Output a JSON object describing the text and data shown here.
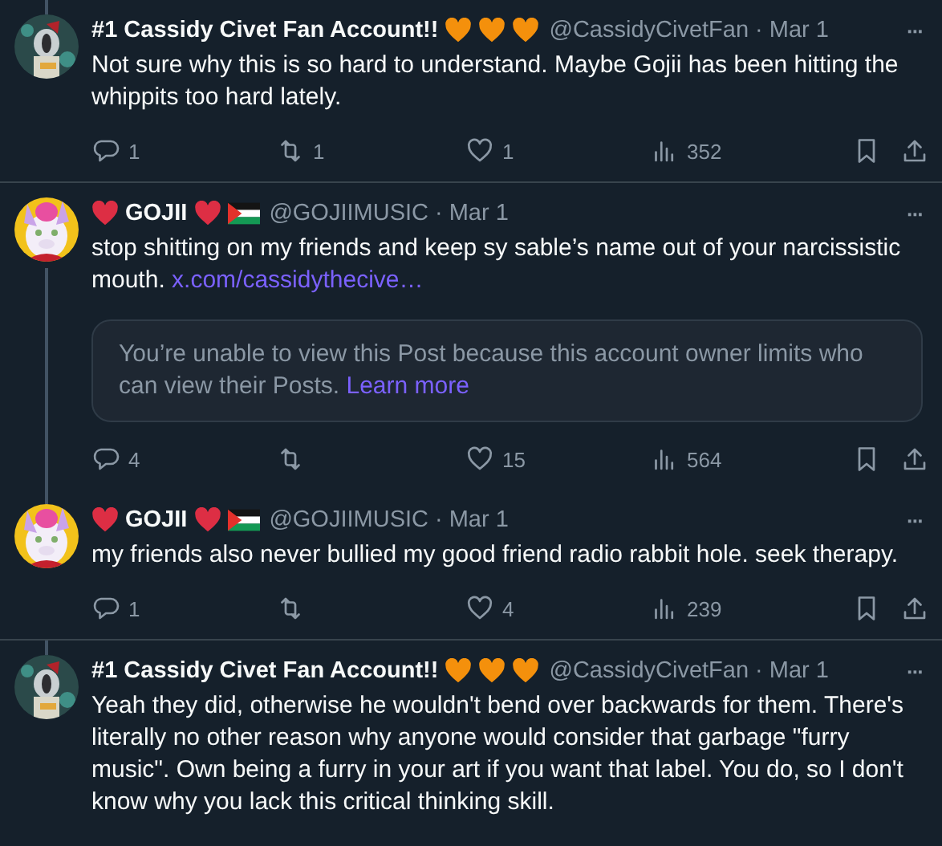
{
  "posts": [
    {
      "name_parts": [
        {
          "kind": "text",
          "text": "#1 Cassidy Civet Fan Account!!"
        },
        {
          "kind": "heart",
          "color": "#f4900c"
        },
        {
          "kind": "heart",
          "color": "#f4900c"
        },
        {
          "kind": "heart",
          "color": "#f4900c"
        }
      ],
      "handle": "@CassidyCivetFan",
      "date": "· Mar 1",
      "more": "···",
      "body": "Not sure why this is so hard to understand. Maybe Gojii has been hitting the whippits too hard lately.",
      "thread_above": true,
      "thread_below": false,
      "actions": {
        "replies": "1",
        "reposts": "1",
        "likes": "1",
        "views": "352"
      },
      "has_actions": true
    },
    {
      "name_parts": [
        {
          "kind": "heart",
          "color": "#dd2e44"
        },
        {
          "kind": "text",
          "text": "GOJII"
        },
        {
          "kind": "heart",
          "color": "#dd2e44"
        },
        {
          "kind": "flag"
        }
      ],
      "handle": "@GOJIIMUSIC",
      "date": "· Mar 1",
      "more": "···",
      "body": "stop shitting on my friends and keep sy sable’s name out of your narcissistic mouth.",
      "link": "x.com/cassidythecive…",
      "notice": {
        "text": "You’re unable to view this Post because this account owner limits who can view their Posts.",
        "link": "Learn more"
      },
      "thread_above": false,
      "thread_below": true,
      "actions": {
        "replies": "4",
        "likes": "15",
        "views": "564"
      },
      "has_actions": true
    },
    {
      "name_parts": [
        {
          "kind": "heart",
          "color": "#dd2e44"
        },
        {
          "kind": "text",
          "text": "GOJII"
        },
        {
          "kind": "heart",
          "color": "#dd2e44"
        },
        {
          "kind": "flag"
        }
      ],
      "handle": "@GOJIIMUSIC",
      "date": "· Mar 1",
      "more": "···",
      "body": "my friends also never bullied my good friend radio rabbit hole. seek therapy.",
      "thread_above": true,
      "thread_below": false,
      "actions": {
        "replies": "1",
        "likes": "4",
        "views": "239"
      },
      "has_actions": true
    },
    {
      "name_parts": [
        {
          "kind": "text",
          "text": "#1 Cassidy Civet Fan Account!!"
        },
        {
          "kind": "heart",
          "color": "#f4900c"
        },
        {
          "kind": "heart",
          "color": "#f4900c"
        },
        {
          "kind": "heart",
          "color": "#f4900c"
        }
      ],
      "handle": "@CassidyCivetFan",
      "date": "· Mar 1",
      "more": "···",
      "body": "Yeah they did, otherwise he wouldn't bend over backwards for them. There's literally no other reason why anyone would consider that garbage \"furry music\". Own being a furry in your art if you want that label. You do, so I don't know why you lack this critical thinking skill.",
      "thread_above": true,
      "thread_below": false,
      "has_actions": false
    }
  ]
}
